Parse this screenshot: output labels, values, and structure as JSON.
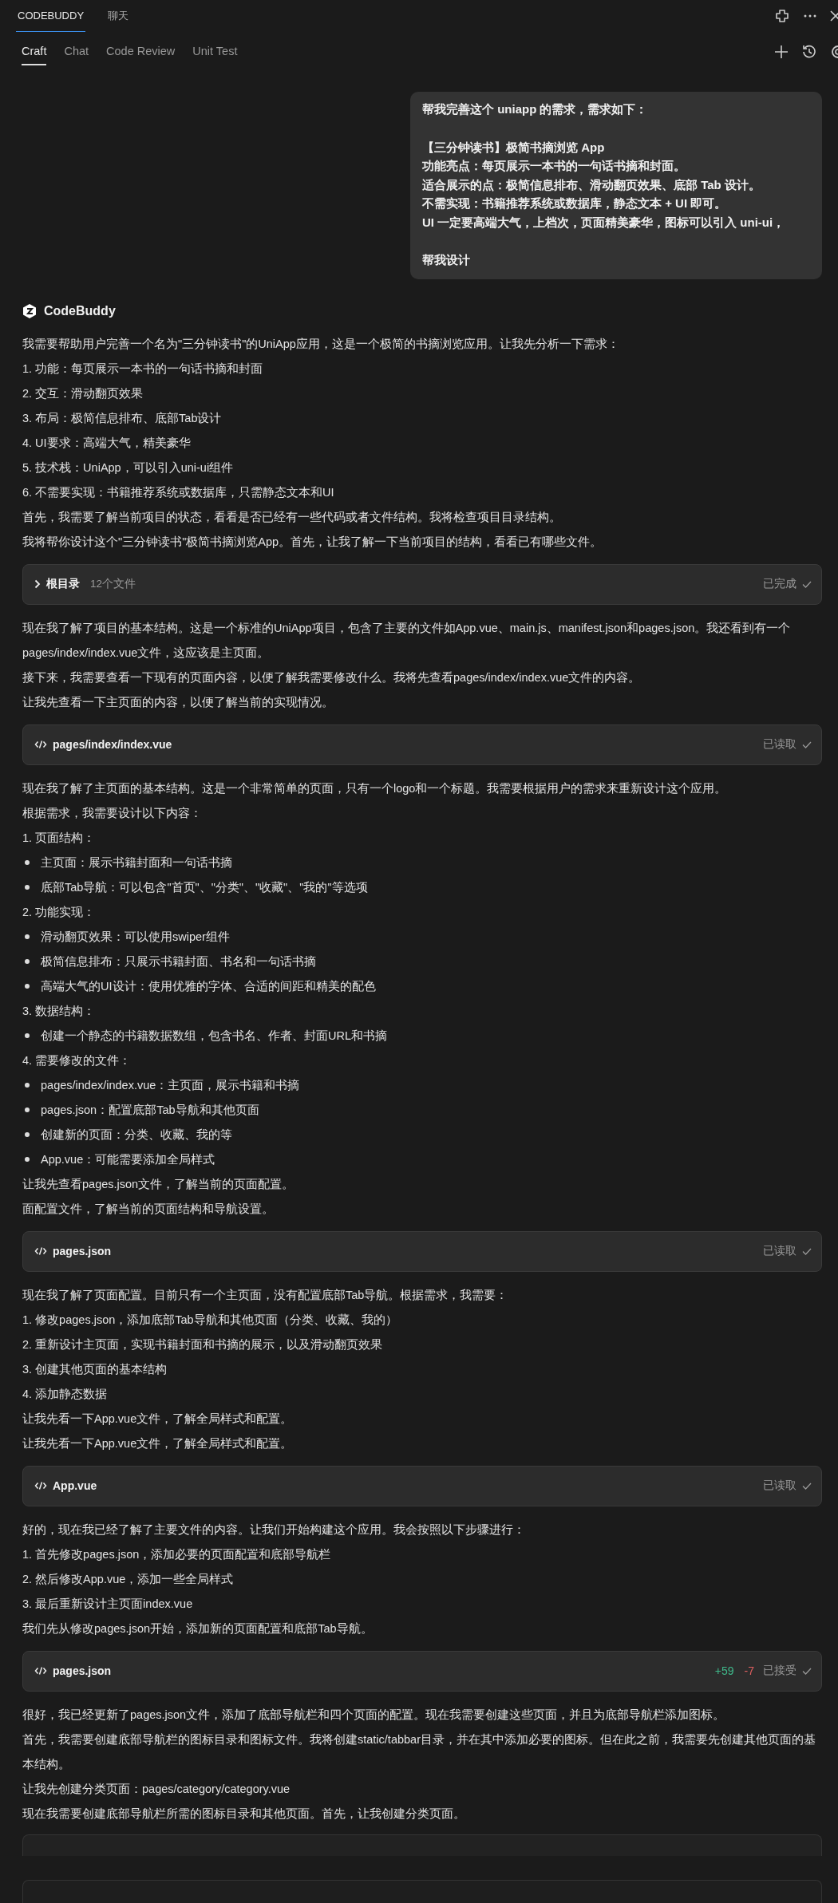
{
  "top_tabs": [
    {
      "label": "CODEBUDDY",
      "selected": true
    },
    {
      "label": "聊天",
      "selected": false
    }
  ],
  "mode_tabs": [
    {
      "label": "Craft",
      "selected": true
    },
    {
      "label": "Chat",
      "selected": false
    },
    {
      "label": "Code Review",
      "selected": false
    },
    {
      "label": "Unit Test",
      "selected": false
    }
  ],
  "user_message": {
    "paragraphs": [
      [
        "帮我完善这个 uniapp 的需求，需求如下："
      ],
      [
        "【三分钟读书】极简书摘浏览 App",
        "功能亮点：每页展示一本书的一句话书摘和封面。",
        "适合展示的点：极简信息排布、滑动翻页效果、底部 Tab 设计。",
        "不需实现：书籍推荐系统或数据库，静态文本 + UI 即可。",
        "UI 一定要高端大气，上档次，页面精美豪华，图标可以引入 uni-ui，"
      ],
      [
        "帮我设计"
      ]
    ]
  },
  "assistant": {
    "name": "CodeBuddy",
    "blocks": [
      {
        "kind": "text",
        "text": "我需要帮助用户完善一个名为\"三分钟读书\"的UniApp应用，这是一个极简的书摘浏览应用。让我先分析一下需求："
      },
      {
        "kind": "text",
        "text": "1. 功能：每页展示一本书的一句话书摘和封面"
      },
      {
        "kind": "text",
        "text": "2. 交互：滑动翻页效果"
      },
      {
        "kind": "text",
        "text": "3. 布局：极简信息排布、底部Tab设计"
      },
      {
        "kind": "text",
        "text": "4. UI要求：高端大气，精美豪华"
      },
      {
        "kind": "text",
        "text": "5. 技术栈：UniApp，可以引入uni-ui组件"
      },
      {
        "kind": "text",
        "text": "6. 不需要实现：书籍推荐系统或数据库，只需静态文本和UI"
      },
      {
        "kind": "text",
        "text": "首先，我需要了解当前项目的状态，看看是否已经有一些代码或者文件结构。我将检查项目目录结构。"
      },
      {
        "kind": "text",
        "text": "我将帮你设计这个\"三分钟读书\"极简书摘浏览App。首先，让我了解一下当前项目的结构，看看已有哪些文件。"
      },
      {
        "kind": "folder_card",
        "title": "根目录",
        "subtitle": "12个文件",
        "status": "已完成"
      },
      {
        "kind": "text",
        "text": "现在我了解了项目的基本结构。这是一个标准的UniApp项目，包含了主要的文件如App.vue、main.js、manifest.json和pages.json。我还看到有一个pages/index/index.vue文件，这应该是主页面。"
      },
      {
        "kind": "text",
        "text": "接下来，我需要查看一下现有的页面内容，以便了解我需要修改什么。我将先查看pages/index/index.vue文件的内容。"
      },
      {
        "kind": "text",
        "text": "让我先查看一下主页面的内容，以便了解当前的实现情况。"
      },
      {
        "kind": "file_card",
        "title": "pages/index/index.vue",
        "status": "已读取"
      },
      {
        "kind": "text",
        "text": "现在我了解了主页面的基本结构。这是一个非常简单的页面，只有一个logo和一个标题。我需要根据用户的需求来重新设计这个应用。"
      },
      {
        "kind": "text",
        "text": "根据需求，我需要设计以下内容："
      },
      {
        "kind": "text",
        "text": "1. 页面结构："
      },
      {
        "kind": "bullet",
        "text": "主页面：展示书籍封面和一句话书摘"
      },
      {
        "kind": "bullet",
        "text": "底部Tab导航：可以包含\"首页\"、\"分类\"、\"收藏\"、\"我的\"等选项"
      },
      {
        "kind": "text",
        "text": "2. 功能实现："
      },
      {
        "kind": "bullet",
        "text": "滑动翻页效果：可以使用swiper组件"
      },
      {
        "kind": "bullet",
        "text": "极简信息排布：只展示书籍封面、书名和一句话书摘"
      },
      {
        "kind": "bullet",
        "text": "高端大气的UI设计：使用优雅的字体、合适的间距和精美的配色"
      },
      {
        "kind": "text",
        "text": "3. 数据结构："
      },
      {
        "kind": "bullet",
        "text": "创建一个静态的书籍数据数组，包含书名、作者、封面URL和书摘"
      },
      {
        "kind": "text",
        "text": "4. 需要修改的文件："
      },
      {
        "kind": "bullet",
        "text": "pages/index/index.vue：主页面，展示书籍和书摘"
      },
      {
        "kind": "bullet",
        "text": "pages.json：配置底部Tab导航和其他页面"
      },
      {
        "kind": "bullet",
        "text": "创建新的页面：分类、收藏、我的等"
      },
      {
        "kind": "bullet",
        "text": "App.vue：可能需要添加全局样式"
      },
      {
        "kind": "text",
        "text": "让我先查看pages.json文件，了解当前的页面配置。"
      },
      {
        "kind": "text",
        "text": "面配置文件，了解当前的页面结构和导航设置。"
      },
      {
        "kind": "file_card",
        "title": "pages.json",
        "status": "已读取"
      },
      {
        "kind": "text",
        "text": "现在我了解了页面配置。目前只有一个主页面，没有配置底部Tab导航。根据需求，我需要："
      },
      {
        "kind": "text",
        "text": "1. 修改pages.json，添加底部Tab导航和其他页面（分类、收藏、我的）"
      },
      {
        "kind": "text",
        "text": "2. 重新设计主页面，实现书籍封面和书摘的展示，以及滑动翻页效果"
      },
      {
        "kind": "text",
        "text": "3. 创建其他页面的基本结构"
      },
      {
        "kind": "text",
        "text": "4. 添加静态数据"
      },
      {
        "kind": "text",
        "text": "让我先看一下App.vue文件，了解全局样式和配置。"
      },
      {
        "kind": "text",
        "text": "让我先看一下App.vue文件，了解全局样式和配置。"
      },
      {
        "kind": "file_card",
        "title": "App.vue",
        "status": "已读取"
      },
      {
        "kind": "text",
        "text": "好的，现在我已经了解了主要文件的内容。让我们开始构建这个应用。我会按照以下步骤进行："
      },
      {
        "kind": "text",
        "text": "1. 首先修改pages.json，添加必要的页面配置和底部导航栏"
      },
      {
        "kind": "text",
        "text": "2. 然后修改App.vue，添加一些全局样式"
      },
      {
        "kind": "text",
        "text": "3. 最后重新设计主页面index.vue"
      },
      {
        "kind": "text",
        "text": "我们先从修改pages.json开始，添加新的页面配置和底部Tab导航。"
      },
      {
        "kind": "file_card",
        "title": "pages.json",
        "status": "已接受",
        "additions": "+59",
        "deletions": "-7"
      },
      {
        "kind": "text",
        "text": "很好，我已经更新了pages.json文件，添加了底部导航栏和四个页面的配置。现在我需要创建这些页面，并且为底部导航栏添加图标。"
      },
      {
        "kind": "text",
        "text": "首先，我需要创建底部导航栏的图标目录和图标文件。我将创建static/tabbar目录，并在其中添加必要的图标。但在此之前，我需要先创建其他页面的基本结构。"
      },
      {
        "kind": "text",
        "text": "让我先创建分类页面：pages/category/category.vue"
      },
      {
        "kind": "text",
        "text": "现在我需要创建底部导航栏所需的图标目录和其他页面。首先，让我创建分类页面。"
      },
      {
        "kind": "cut_card"
      },
      {
        "kind": "cut_card"
      }
    ]
  }
}
